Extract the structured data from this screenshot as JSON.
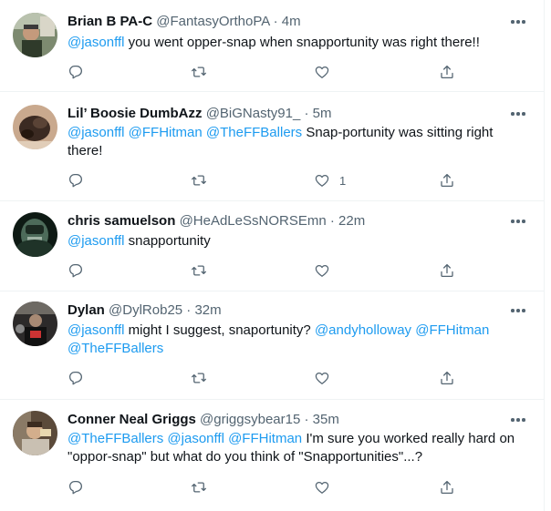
{
  "tweets": [
    {
      "name": "Brian B PA-C",
      "handle": "@FantasyOrthoPA",
      "dot": "·",
      "time": "4m",
      "line1": [
        {
          "t": "@jasonffl",
          "mention": true
        },
        {
          "t": " you went opper-snap when snapportunity was right there!!",
          "mention": false
        }
      ],
      "line2": [],
      "like_count": ""
    },
    {
      "name": "Lil’ Boosie DumbAzz",
      "handle": "@BiGNasty91_",
      "dot": "·",
      "time": "5m",
      "line1": [
        {
          "t": "@jasonffl",
          "mention": true
        },
        {
          "t": " ",
          "mention": false
        },
        {
          "t": "@FFHitman",
          "mention": true
        },
        {
          "t": " ",
          "mention": false
        },
        {
          "t": "@TheFFBallers",
          "mention": true
        },
        {
          "t": " Snap-portunity was sitting right",
          "mention": false
        }
      ],
      "line2": [
        {
          "t": "there!",
          "mention": false
        }
      ],
      "like_count": "1"
    },
    {
      "name": "chris samuelson",
      "handle": "@HeAdLeSsNORSEmn",
      "dot": "·",
      "time": "22m",
      "line1": [
        {
          "t": "@jasonffl",
          "mention": true
        },
        {
          "t": " snapportunity",
          "mention": false
        }
      ],
      "line2": [],
      "like_count": ""
    },
    {
      "name": "Dylan",
      "handle": "@DylRob25",
      "dot": "·",
      "time": "32m",
      "line1": [
        {
          "t": "@jasonffl",
          "mention": true
        },
        {
          "t": " might I suggest, snaportunity? ",
          "mention": false
        },
        {
          "t": "@andyholloway",
          "mention": true
        },
        {
          "t": " ",
          "mention": false
        },
        {
          "t": "@FFHitman",
          "mention": true
        }
      ],
      "line2": [
        {
          "t": "@TheFFBallers",
          "mention": true
        }
      ],
      "like_count": ""
    },
    {
      "name": "Conner Neal Griggs",
      "handle": "@griggsybear15",
      "dot": "·",
      "time": "35m",
      "line1": [
        {
          "t": "@TheFFBallers",
          "mention": true
        },
        {
          "t": " ",
          "mention": false
        },
        {
          "t": "@jasonffl",
          "mention": true
        },
        {
          "t": " ",
          "mention": false
        },
        {
          "t": "@FFHitman",
          "mention": true
        },
        {
          "t": " I'm sure you worked really hard on",
          "mention": false
        }
      ],
      "line2": [
        {
          "t": "\"oppor-snap\" but what do you think of \"Snapportunities\"...?",
          "mention": false
        }
      ],
      "like_count": ""
    }
  ],
  "icons": {
    "reply": "reply-icon",
    "retweet": "retweet-icon",
    "like": "like-icon",
    "share": "share-icon",
    "more": "more-icon"
  },
  "colors": {
    "mention": "#1d9bf0",
    "secondary_text": "#536471",
    "divider": "#eff3f4"
  }
}
